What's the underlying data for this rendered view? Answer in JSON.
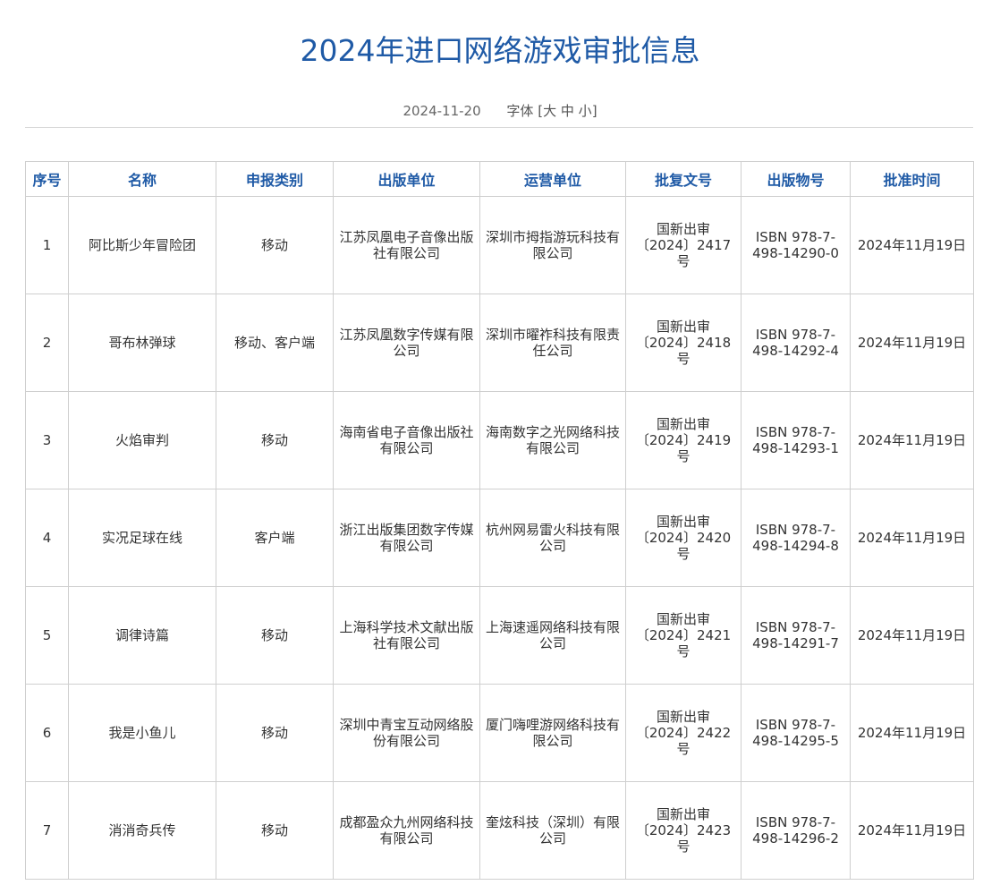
{
  "page": {
    "title": "2024年进口网络游戏审批信息",
    "date": "2024-11-20",
    "font_label": "字体",
    "font_bracket_open": "[",
    "font_large": "大",
    "font_medium": "中",
    "font_small": "小",
    "font_bracket_close": "]"
  },
  "table": {
    "headers": [
      "序号",
      "名称",
      "申报类别",
      "出版单位",
      "运营单位",
      "批复文号",
      "出版物号",
      "批准时间"
    ],
    "rows": [
      {
        "no": "1",
        "name": "阿比斯少年冒险团",
        "category": "移动",
        "publisher": "江苏凤凰电子音像出版社有限公司",
        "operator": "深圳市拇指游玩科技有限公司",
        "approval_line1": "国新出审",
        "approval_line2": "〔2024〕2417",
        "approval_line3": "号",
        "isbn_line1": "ISBN 978-7-",
        "isbn_line2": "498-14290-0",
        "date": "2024年11月19日"
      },
      {
        "no": "2",
        "name": "哥布林弹球",
        "category": "移动、客户端",
        "publisher": "江苏凤凰数字传媒有限公司",
        "operator": "深圳市曜祚科技有限责任公司",
        "approval_line1": "国新出审",
        "approval_line2": "〔2024〕2418",
        "approval_line3": "号",
        "isbn_line1": "ISBN 978-7-",
        "isbn_line2": "498-14292-4",
        "date": "2024年11月19日"
      },
      {
        "no": "3",
        "name": "火焰审判",
        "category": "移动",
        "publisher": "海南省电子音像出版社有限公司",
        "operator": "海南数字之光网络科技有限公司",
        "approval_line1": "国新出审",
        "approval_line2": "〔2024〕2419",
        "approval_line3": "号",
        "isbn_line1": "ISBN 978-7-",
        "isbn_line2": "498-14293-1",
        "date": "2024年11月19日"
      },
      {
        "no": "4",
        "name": "实况足球在线",
        "category": "客户端",
        "publisher": "浙江出版集团数字传媒有限公司",
        "operator": "杭州网易雷火科技有限公司",
        "approval_line1": "国新出审",
        "approval_line2": "〔2024〕2420",
        "approval_line3": "号",
        "isbn_line1": "ISBN 978-7-",
        "isbn_line2": "498-14294-8",
        "date": "2024年11月19日"
      },
      {
        "no": "5",
        "name": "调律诗篇",
        "category": "移动",
        "publisher": "上海科学技术文献出版社有限公司",
        "operator": "上海速遥网络科技有限公司",
        "approval_line1": "国新出审",
        "approval_line2": "〔2024〕2421",
        "approval_line3": "号",
        "isbn_line1": "ISBN 978-7-",
        "isbn_line2": "498-14291-7",
        "date": "2024年11月19日"
      },
      {
        "no": "6",
        "name": "我是小鱼儿",
        "category": "移动",
        "publisher": "深圳中青宝互动网络股份有限公司",
        "operator": "厦门嗨哩游网络科技有限公司",
        "approval_line1": "国新出审",
        "approval_line2": "〔2024〕2422",
        "approval_line3": "号",
        "isbn_line1": "ISBN 978-7-",
        "isbn_line2": "498-14295-5",
        "date": "2024年11月19日"
      },
      {
        "no": "7",
        "name": "消消奇兵传",
        "category": "移动",
        "publisher": "成都盈众九州网络科技有限公司",
        "operator": "奎炫科技（深圳）有限公司",
        "approval_line1": "国新出审",
        "approval_line2": "〔2024〕2423",
        "approval_line3": "号",
        "isbn_line1": "ISBN 978-7-",
        "isbn_line2": "498-14296-2",
        "date": "2024年11月19日"
      }
    ]
  },
  "colors": {
    "accent": "#1f5aa6",
    "border": "#cfcfcf",
    "text": "#333333",
    "meta_text": "#666666"
  }
}
